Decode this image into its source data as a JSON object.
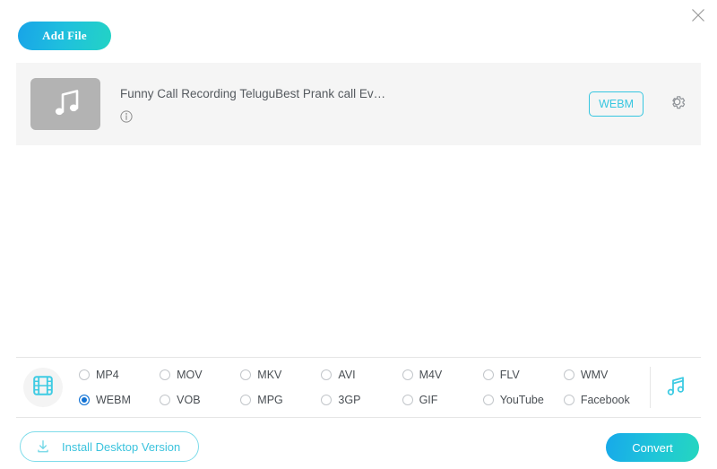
{
  "window": {
    "close_label": "×",
    "close_icon": "close-icon"
  },
  "toolbar": {
    "add_file_label": "Add File"
  },
  "file_list": {
    "items": [
      {
        "title": "Funny Call Recording TeluguBest Prank call Ev…",
        "thumb_icon": "music-note-icon",
        "info_icon": "info-icon",
        "output_format": "WEBM",
        "settings_icon": "gear-icon"
      }
    ]
  },
  "format_panel": {
    "video_tab_icon": "film-strip-icon",
    "audio_tab_icon": "music-note-icon",
    "selected": "WEBM",
    "options": [
      {
        "label": "MP4",
        "selected": false
      },
      {
        "label": "MOV",
        "selected": false
      },
      {
        "label": "MKV",
        "selected": false
      },
      {
        "label": "AVI",
        "selected": false
      },
      {
        "label": "M4V",
        "selected": false
      },
      {
        "label": "FLV",
        "selected": false
      },
      {
        "label": "WMV",
        "selected": false
      },
      {
        "label": "WEBM",
        "selected": true
      },
      {
        "label": "VOB",
        "selected": false
      },
      {
        "label": "MPG",
        "selected": false
      },
      {
        "label": "3GP",
        "selected": false
      },
      {
        "label": "GIF",
        "selected": false
      },
      {
        "label": "YouTube",
        "selected": false
      },
      {
        "label": "Facebook",
        "selected": false
      }
    ]
  },
  "footer": {
    "install_label": "Install Desktop Version",
    "install_icon": "download-icon",
    "convert_label": "Convert"
  },
  "colors": {
    "accent_cyan": "#36c6e0",
    "radio_blue": "#1172d4",
    "row_bg": "#f5f5f5",
    "thumb_gray": "#b3b3b3"
  }
}
